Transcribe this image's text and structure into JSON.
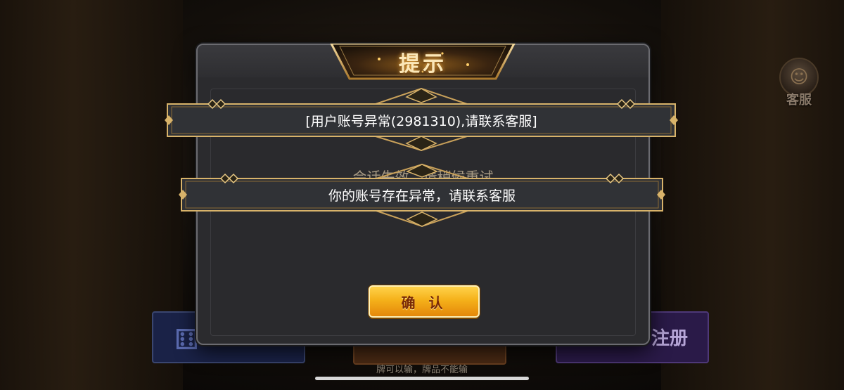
{
  "background": {
    "service_label": "客服",
    "register_label": "注册",
    "slogan": "牌可以输，牌品不能输"
  },
  "dialog": {
    "title": "提示",
    "message": "会话失效，请稍候重试",
    "confirm_label": "确 认"
  },
  "toasts": [
    {
      "text": "[用户账号异常(2981310),请联系客服]"
    },
    {
      "text": "你的账号存在异常，请联系客服"
    }
  ],
  "colors": {
    "gold_accent": "#d8b36a",
    "button_orange": "#f5b11a",
    "title_glow": "#f7b347",
    "dialog_bg": "#2b2b2e"
  }
}
